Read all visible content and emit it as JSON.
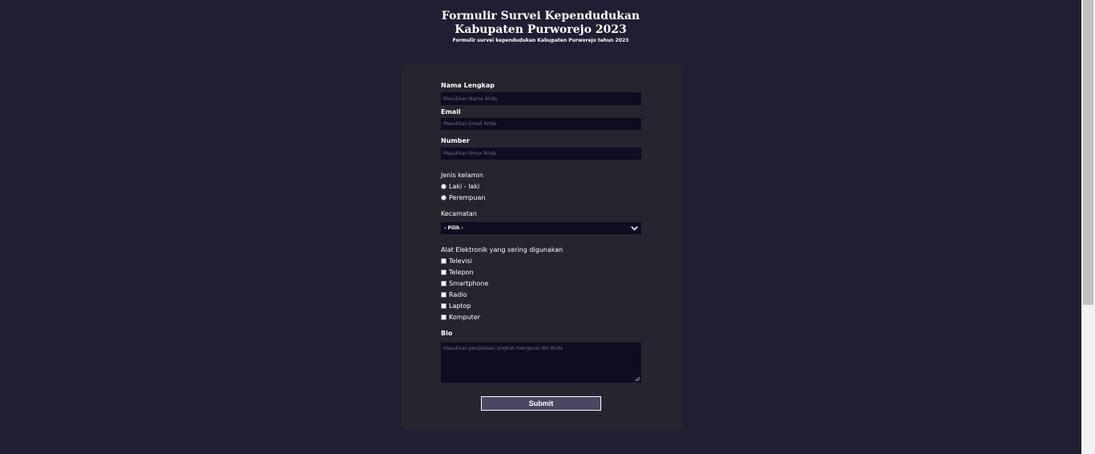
{
  "header": {
    "title_line1": "Formulir Survei Kependudukan",
    "title_line2": "Kabupaten Purworejo 2023",
    "subtitle": "Formulir survei kependudukan Kabupaten Purworejo tahun 2023"
  },
  "form": {
    "name_label": "Nama Lengkap",
    "name_placeholder": "Masukkan Nama Anda",
    "email_label": "Email",
    "email_placeholder": "Masukkan Email Anda",
    "number_label": "Number",
    "number_placeholder": "Masukkan Umur Anda",
    "gender_label": "Jenis kelamin",
    "gender_options": [
      "Laki - laki",
      "Perempuan"
    ],
    "district_label": "Kecamatan",
    "district_selected": "- Pilih -",
    "devices_label": "Alat Elektronik yang sering digunakan",
    "devices": [
      "Televisi",
      "Telepon",
      "Smartphone",
      "Radio",
      "Laptop",
      "Komputer"
    ],
    "bio_label": "Bio",
    "bio_placeholder": "Masukkan penjelasan singkat mengenai diri Anda",
    "submit_label": "Submit"
  }
}
